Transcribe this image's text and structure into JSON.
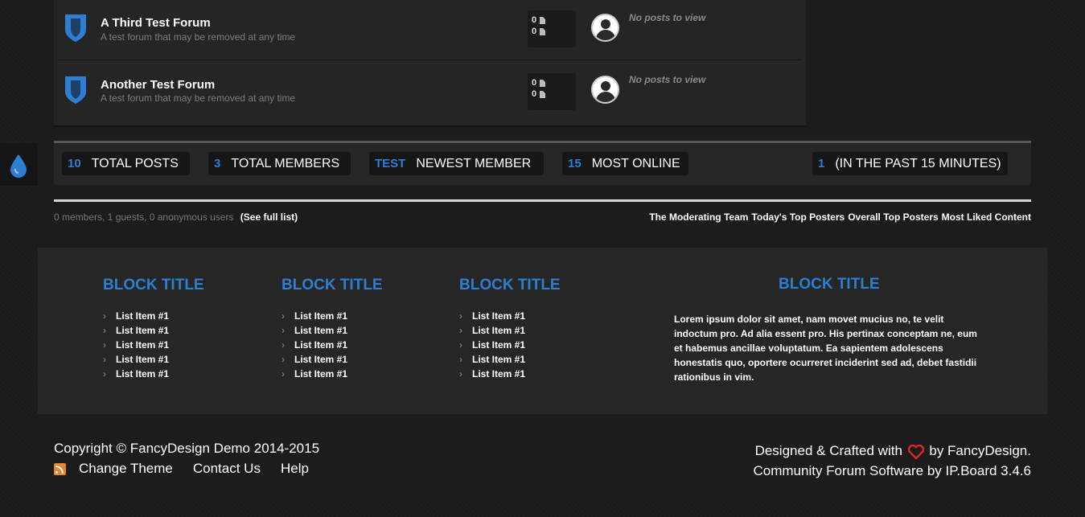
{
  "forums": [
    {
      "title": "A Third Test Forum",
      "description": "A test forum that may be removed at any time",
      "topics": "0",
      "posts": "0",
      "last_post": "No posts to view"
    },
    {
      "title": "Another Test Forum",
      "description": "A test forum that may be removed at any time",
      "topics": "0",
      "posts": "0",
      "last_post": "No posts to view"
    }
  ],
  "stats": {
    "total_posts": {
      "num": "10",
      "label": "TOTAL POSTS"
    },
    "total_members": {
      "num": "3",
      "label": "TOTAL MEMBERS"
    },
    "newest_member": {
      "num": "TEST",
      "label": "NEWEST MEMBER"
    },
    "most_online": {
      "num": "15",
      "label": "MOST ONLINE"
    },
    "online_now": {
      "num": "1",
      "label": "(IN THE PAST 15 MINUTES)"
    }
  },
  "online": {
    "text": "0 members, 1 guests, 0 anonymous users",
    "link": "(See full list)"
  },
  "top_links": [
    "The Moderating Team",
    "Today's Top Posters",
    "Overall Top Posters",
    "Most Liked Content"
  ],
  "blocks": [
    {
      "title": "BLOCK TITLE",
      "items": [
        "List Item #1",
        "List Item #1",
        "List Item #1",
        "List Item #1",
        "List Item #1"
      ]
    },
    {
      "title": "BLOCK TITLE",
      "items": [
        "List Item #1",
        "List Item #1",
        "List Item #1",
        "List Item #1",
        "List Item #1"
      ]
    },
    {
      "title": "BLOCK TITLE",
      "items": [
        "List Item #1",
        "List Item #1",
        "List Item #1",
        "List Item #1",
        "List Item #1"
      ]
    }
  ],
  "block4": {
    "title": "BLOCK TITLE",
    "text": "Lorem ipsum dolor sit amet, nam movet mucius no, te velit indoctum pro. Ad alia essent pro. His pertinax conceptam ne, eum et habemus ancillae voluptatum. Ea sapientem adolescens honestatis quo, oportere ocurreret inciderint sed ad, debet fastidii rationibus in vim."
  },
  "footer": {
    "copyright": "Copyright © FancyDesign Demo 2014-2015",
    "links": [
      "Change Theme",
      "Contact Us",
      "Help"
    ],
    "designed_prefix": "Designed & Crafted with",
    "designed_suffix": "by FancyDesign.",
    "software": "Community Forum Software by IP.Board 3.4.6"
  },
  "colors": {
    "accent": "#2e7fd1",
    "heart": "#e02424",
    "rss": "#e8822e"
  },
  "icons": {
    "forum": "shield-icon",
    "side": "water-drop-icon",
    "avatar": "user-avatar-icon",
    "rss": "rss-icon",
    "heart": "heart-icon"
  }
}
